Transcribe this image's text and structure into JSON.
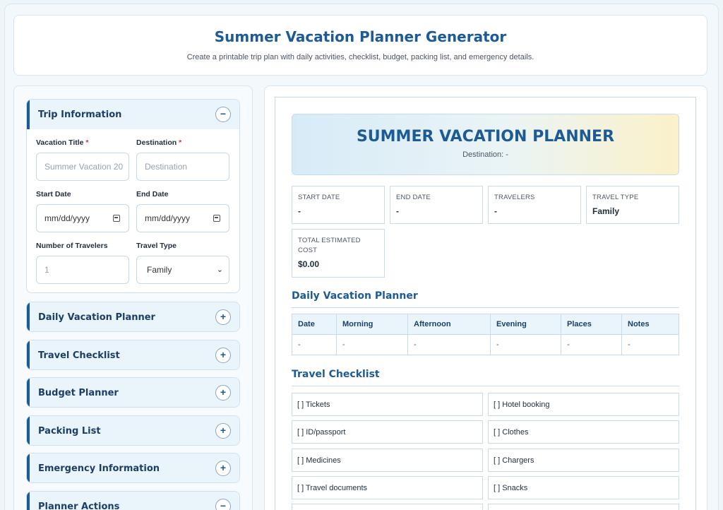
{
  "header": {
    "title": "Summer Vacation Planner Generator",
    "subtitle": "Create a printable trip plan with daily activities, checklist, budget, packing list, and emergency details."
  },
  "sidebar": {
    "trip_info": {
      "title": "Trip Information",
      "toggle": "−",
      "vacation_title_label": "Vacation Title",
      "vacation_title_placeholder": "Summer Vacation 20",
      "destination_label": "Destination",
      "destination_placeholder": "Destination",
      "required_mark": "*",
      "start_date_label": "Start Date",
      "start_date_value": "mm/dd/yyyy",
      "end_date_label": "End Date",
      "end_date_value": "mm/dd/yyyy",
      "travelers_label": "Number of Travelers",
      "travelers_placeholder": "1",
      "travel_type_label": "Travel Type",
      "travel_type_value": "Family"
    },
    "sections": [
      {
        "title": "Daily Vacation Planner",
        "toggle": "+"
      },
      {
        "title": "Travel Checklist",
        "toggle": "+"
      },
      {
        "title": "Budget Planner",
        "toggle": "+"
      },
      {
        "title": "Packing List",
        "toggle": "+"
      },
      {
        "title": "Emergency Information",
        "toggle": "+"
      },
      {
        "title": "Planner Actions",
        "toggle": "−"
      }
    ]
  },
  "preview": {
    "banner_title": "SUMMER VACATION PLANNER",
    "banner_destination": "Destination: -",
    "cards": [
      {
        "label": "START DATE",
        "value": "-"
      },
      {
        "label": "END DATE",
        "value": "-"
      },
      {
        "label": "TRAVELERS",
        "value": "-"
      },
      {
        "label": "TRAVEL TYPE",
        "value": "Family"
      },
      {
        "label": "TOTAL ESTIMATED COST",
        "value": "$0.00"
      }
    ],
    "daily_title": "Daily Vacation Planner",
    "daily_columns": [
      "Date",
      "Morning",
      "Afternoon",
      "Evening",
      "Places",
      "Notes"
    ],
    "daily_row": [
      "-",
      "-",
      "-",
      "-",
      "-",
      "-"
    ],
    "checklist_title": "Travel Checklist",
    "checklist": [
      "[ ] Tickets",
      "[ ] Hotel booking",
      "[ ] ID/passport",
      "[ ] Clothes",
      "[ ] Medicines",
      "[ ] Chargers",
      "[ ] Travel documents",
      "[ ] Snacks"
    ]
  }
}
